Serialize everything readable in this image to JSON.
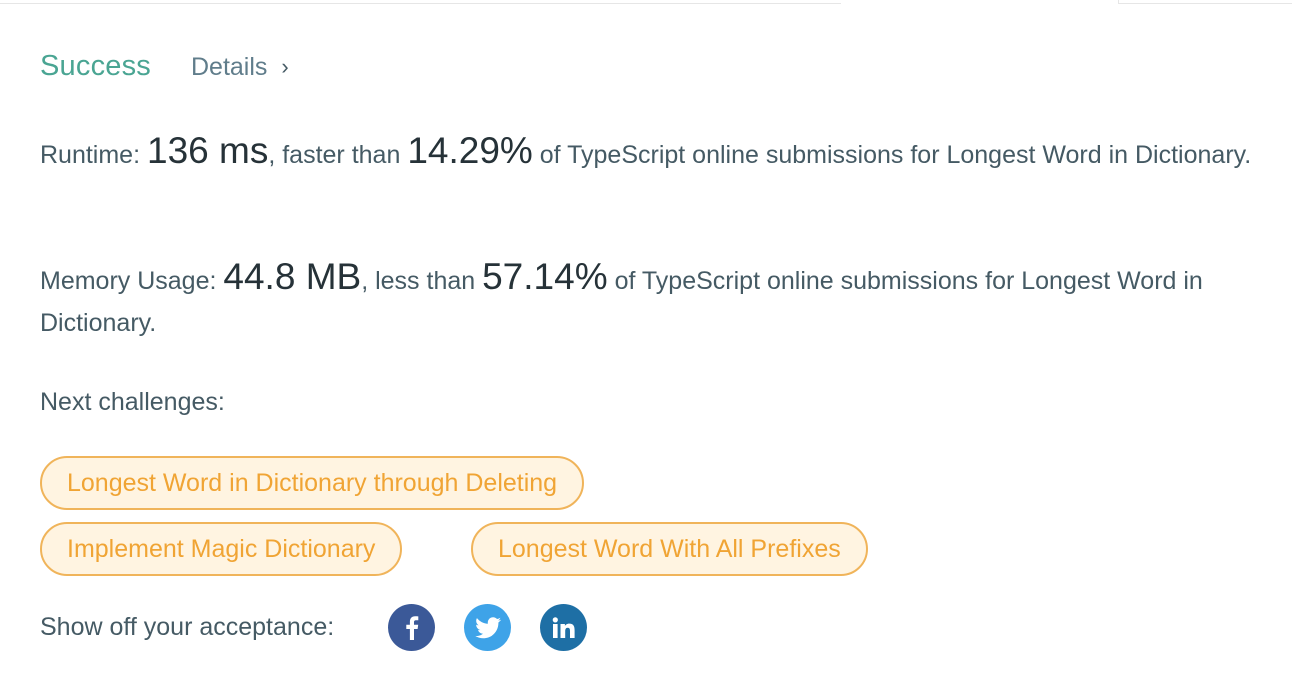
{
  "result": {
    "status": "Success",
    "details_label": "Details",
    "details_chevron": "›"
  },
  "runtime": {
    "label": "Runtime:",
    "value": "136 ms",
    "comparison": ", faster than",
    "percent": "14.29%",
    "suffix": "of TypeScript online submissions for Longest Word in Dictionary."
  },
  "memory": {
    "label": "Memory Usage:",
    "value": "44.8 MB",
    "comparison": ", less than",
    "percent": "57.14%",
    "suffix": "of TypeScript online submissions for Longest Word in Dictionary."
  },
  "next": {
    "label": "Next challenges:",
    "challenges": [
      "Longest Word in Dictionary through Deleting",
      "Implement Magic Dictionary",
      "Longest Word With All Prefixes"
    ]
  },
  "share": {
    "label": "Show off your acceptance:",
    "icons": [
      "facebook-icon",
      "twitter-icon",
      "linkedin-icon"
    ],
    "colors": {
      "facebook": "#3b5998",
      "twitter": "#3ea3e8",
      "linkedin": "#1e6fa5"
    }
  },
  "colors": {
    "success": "#4aa593",
    "chip_border": "#f0b45a",
    "chip_bg": "#fff4e1",
    "chip_text": "#f0a434"
  }
}
